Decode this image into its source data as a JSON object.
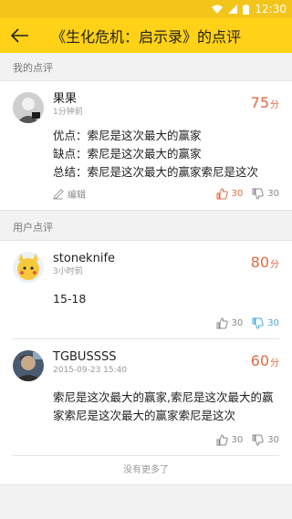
{
  "status": {
    "time": "12:30"
  },
  "appbar": {
    "title": "《生化危机：启示录》的点评"
  },
  "sections": {
    "mine": "我的点评",
    "users": "用户点评"
  },
  "my_review": {
    "name": "果果",
    "time": "1分钟前",
    "score": "75",
    "score_unit": "分",
    "pros": "优点：索尼是这次最大的赢家",
    "cons": "缺点：索尼是这次最大的赢家",
    "summary": "总结：索尼是这次最大的赢家索尼是这次",
    "edit_label": "编辑",
    "likes": "30",
    "dislikes": "30"
  },
  "user_reviews": [
    {
      "name": "stoneknife",
      "time": "3小时前",
      "score": "80",
      "score_unit": "分",
      "text": "15-18",
      "likes": "30",
      "dislikes": "30"
    },
    {
      "name": "TGBUSSSS",
      "time": "2015-09-23 15:40",
      "score": "60",
      "score_unit": "分",
      "text": "索尼是这次最大的赢家,索尼是这次最大的赢家索尼是这次最大的赢家索尼是这次",
      "likes": "30",
      "dislikes": "30"
    }
  ],
  "footer": {
    "no_more": "没有更多了"
  },
  "colors": {
    "appbar": "#ffd117",
    "statusbar": "#f3c51a",
    "score": "#e06b44",
    "dislike_active": "#4aa7d6"
  }
}
